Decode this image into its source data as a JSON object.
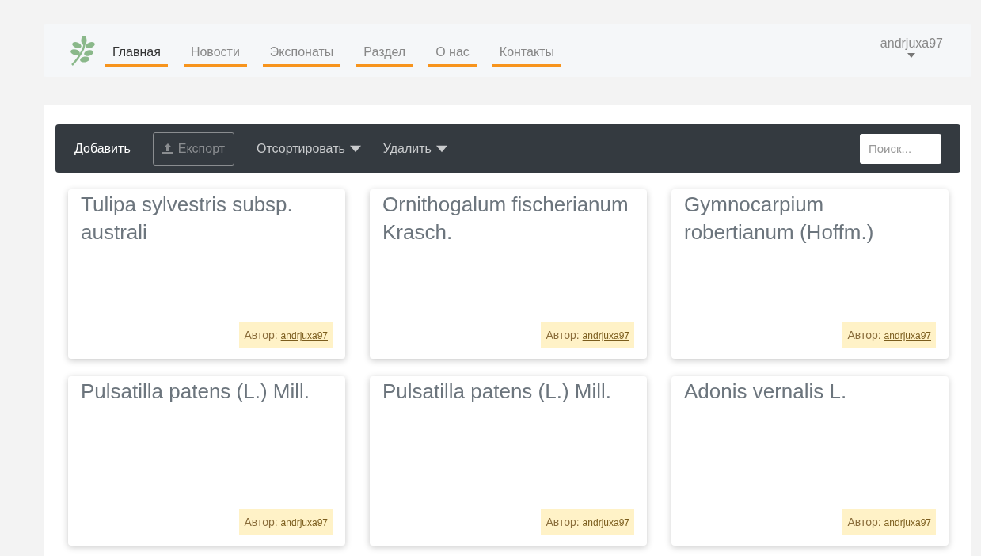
{
  "nav": {
    "items": [
      {
        "label": "Главная",
        "selected": true
      },
      {
        "label": "Новости",
        "selected": false
      },
      {
        "label": "Экспонаты",
        "selected": false
      },
      {
        "label": "Раздел",
        "selected": false
      },
      {
        "label": "О нас",
        "selected": false
      },
      {
        "label": "Контакты",
        "selected": false
      }
    ],
    "user": "andrjuxa97"
  },
  "toolbar": {
    "items": [
      {
        "kind": "button",
        "label": "Добавить",
        "disabled": false
      },
      {
        "kind": "export",
        "label": "Експорт",
        "disabled": true
      },
      {
        "kind": "dropdown",
        "label": "Отсортировать",
        "disabled": false
      },
      {
        "kind": "dropdown",
        "label": "Удалить",
        "disabled": false
      }
    ],
    "search": {
      "placeholder": "Поиск..."
    }
  },
  "cards": [
    {
      "title": "Tulipa sylvestris subsp. australi",
      "author_label": "Автор:",
      "author": "andrjuxa97"
    },
    {
      "title": "Ornithogalum fischerianum Krasch.",
      "author_label": "Автор:",
      "author": "andrjuxa97"
    },
    {
      "title": "Gymnocarpium robertianum (Hoffm.)",
      "author_label": "Автор:",
      "author": "andrjuxa97"
    },
    {
      "title": "Pulsatilla patens (L.) Mill.",
      "author_label": "Автор:",
      "author": "andrjuxa97"
    },
    {
      "title": "Pulsatilla patens (L.) Mill.",
      "author_label": "Автор:",
      "author": "andrjuxa97"
    },
    {
      "title": "Adonis vernalis L.",
      "author_label": "Автор:",
      "author": "andrjuxa97"
    }
  ]
}
